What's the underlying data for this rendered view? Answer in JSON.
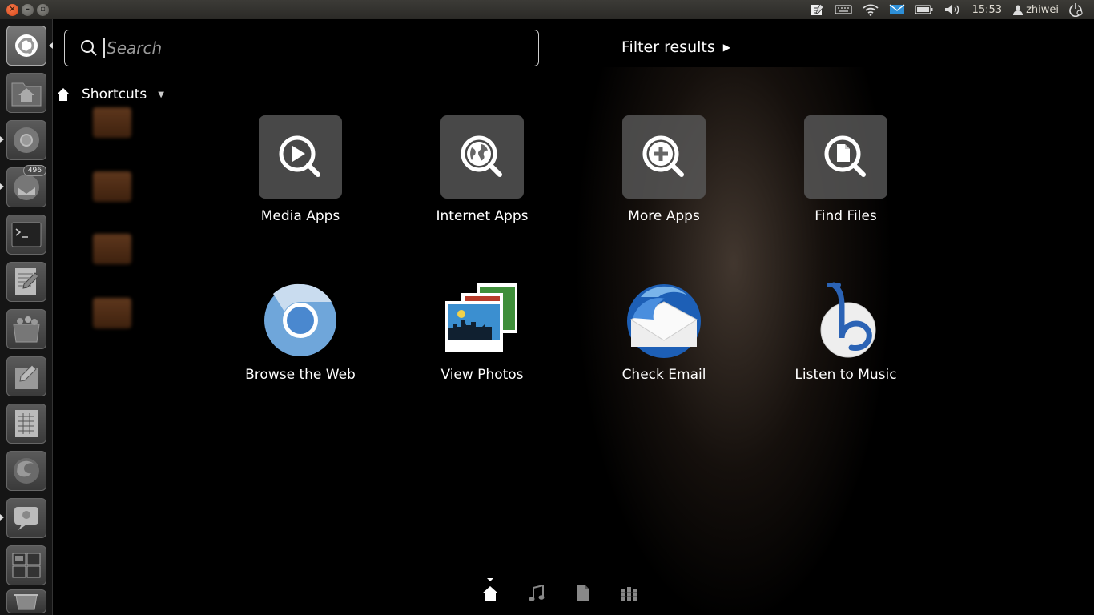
{
  "panel": {
    "clock": "15:53",
    "user": "zhiwei"
  },
  "launcher": {
    "items": [
      {
        "name": "dash-home",
        "label": "Dash home"
      },
      {
        "name": "home-folder",
        "label": "Home Folder"
      },
      {
        "name": "chromium",
        "label": "Chromium"
      },
      {
        "name": "thunderbird",
        "label": "Thunderbird",
        "badge": "496"
      },
      {
        "name": "terminal",
        "label": "Terminal"
      },
      {
        "name": "text-editor",
        "label": "Text Editor"
      },
      {
        "name": "software-center",
        "label": "Software Center"
      },
      {
        "name": "writer",
        "label": "Writer"
      },
      {
        "name": "calc",
        "label": "Calc"
      },
      {
        "name": "firefox",
        "label": "Firefox"
      },
      {
        "name": "empathy",
        "label": "Empathy"
      },
      {
        "name": "workspace-switcher",
        "label": "Workspace Switcher"
      },
      {
        "name": "trash",
        "label": "Trash"
      }
    ]
  },
  "search": {
    "placeholder": "Search"
  },
  "filter": {
    "label": "Filter results"
  },
  "lens": {
    "title": "Shortcuts"
  },
  "shortcuts": [
    {
      "label": "Media Apps",
      "icon": "media-search-icon"
    },
    {
      "label": "Internet Apps",
      "icon": "internet-search-icon"
    },
    {
      "label": "More Apps",
      "icon": "more-apps-search-icon"
    },
    {
      "label": "Find Files",
      "icon": "file-search-icon"
    }
  ],
  "apps": [
    {
      "label": "Browse the Web",
      "icon": "chromium-icon"
    },
    {
      "label": "View Photos",
      "icon": "photos-icon"
    },
    {
      "label": "Check Email",
      "icon": "thunderbird-icon"
    },
    {
      "label": "Listen to Music",
      "icon": "banshee-icon"
    }
  ],
  "lens_bar": [
    "home-lens",
    "music-lens",
    "files-lens",
    "apps-lens"
  ],
  "colors": {
    "panel": "#3c3b37",
    "close_button": "#e05a2b",
    "tile_bg": "#5a5a5a"
  }
}
